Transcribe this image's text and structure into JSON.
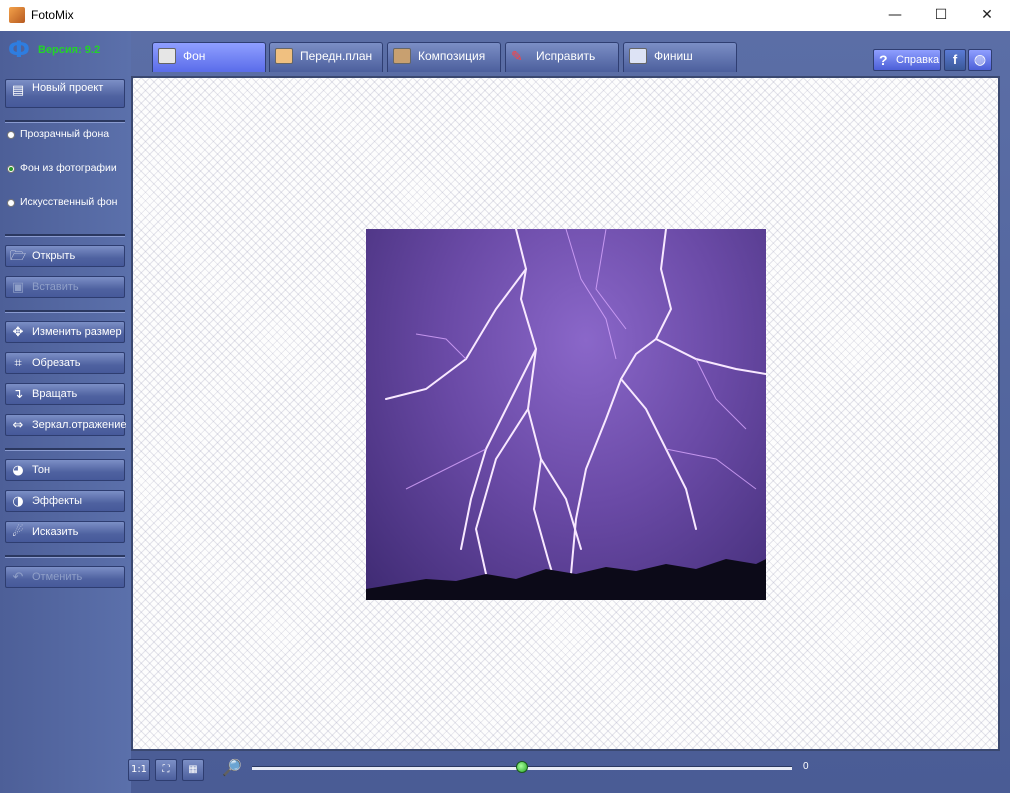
{
  "window": {
    "title": "FotoMix",
    "controls": {
      "minimize": "—",
      "maximize": "☐",
      "close": "✕"
    }
  },
  "version": "Версия: 9.2",
  "left_panel": {
    "new_project": "Новый проект",
    "background_options": [
      {
        "label": "Прозрачный фона",
        "selected": false
      },
      {
        "label": "Фон из фотографии",
        "selected": true
      },
      {
        "label": "Искусственный фон",
        "selected": false
      }
    ],
    "open": "Открыть",
    "paste": "Вставить",
    "resize": "Изменить размер",
    "crop": "Обрезать",
    "rotate": "Вращать",
    "mirror": "Зеркал.отражение",
    "tone": "Тон",
    "effects": "Эффекты",
    "distort": "Исказить",
    "undo": "Отменить"
  },
  "tabs": [
    "Фон",
    "Передн.план",
    "Композиция",
    "Исправить",
    "Финиш"
  ],
  "active_tab": "Фон",
  "top_right": {
    "help": "Справка",
    "facebook": "f",
    "web": "globe-icon"
  },
  "zoom": {
    "value": "0",
    "slider_fraction": 0.5
  },
  "colors": {
    "accent": "#5a6cea",
    "version_green": "#23d32a",
    "frame": "#4a5c95"
  }
}
